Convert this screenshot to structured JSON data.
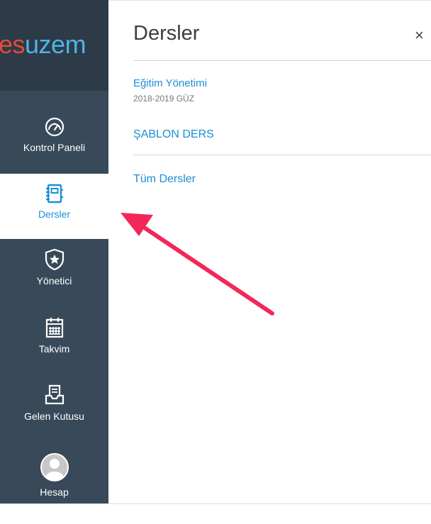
{
  "logo": {
    "part1": "es",
    "part2": "uzem"
  },
  "nav": [
    {
      "label": "Kontrol Paneli",
      "icon": "dashboard-icon"
    },
    {
      "label": "Dersler",
      "icon": "courses-icon",
      "active": true
    },
    {
      "label": "Yönetici",
      "icon": "admin-icon"
    },
    {
      "label": "Takvim",
      "icon": "calendar-icon"
    },
    {
      "label": "Gelen Kutusu",
      "icon": "inbox-icon"
    },
    {
      "label": "Hesap",
      "icon": "account-avatar-icon"
    }
  ],
  "tray": {
    "title": "Dersler",
    "close": "×",
    "course": {
      "name": "Eğitim Yönetimi",
      "term": "2018-2019 GÜZ"
    },
    "template_course": "ŞABLON DERS",
    "all_courses": "Tüm Dersler"
  },
  "colors": {
    "sidebar": "#384a5a",
    "accent": "#1a8fd6",
    "arrow": "#f2285a",
    "logo_red": "#e8473b",
    "logo_blue": "#4fb3e8"
  }
}
